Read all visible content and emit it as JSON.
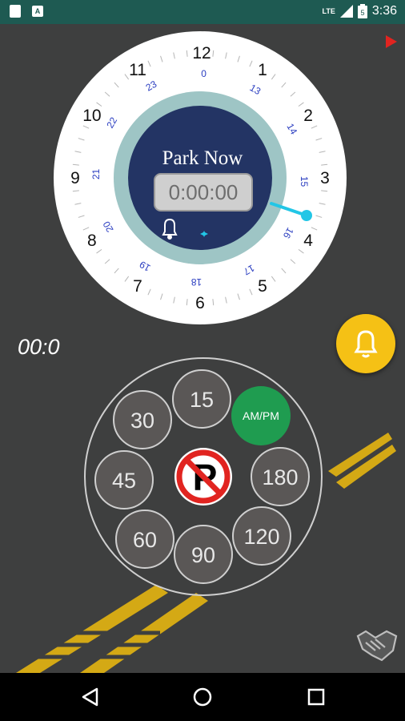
{
  "status_bar": {
    "time": "3:36",
    "network": "LTE",
    "battery_level": "5"
  },
  "dial": {
    "title": "Park Now",
    "timer": "0:00:00",
    "outer_numbers": [
      "12",
      "1",
      "2",
      "3",
      "4",
      "5",
      "6",
      "7",
      "8",
      "9",
      "10",
      "11"
    ],
    "inner_numbers": [
      "0",
      "13",
      "14",
      "15",
      "16",
      "17",
      "18",
      "19",
      "20",
      "21",
      "22",
      "23"
    ]
  },
  "digital_clock": "00:0",
  "quick_durations": {
    "buttons": [
      "15",
      "180",
      "120",
      "90",
      "60",
      "45",
      "30"
    ],
    "ampm_label": "AM/PM"
  },
  "colors": {
    "status_bar": "#1e5a52",
    "background": "#3e3f3f",
    "dial_navy": "#233464",
    "dial_ring": "#9ec5c5",
    "hand": "#22c6e6",
    "alarm": "#f5c115",
    "ampm": "#1f9c50",
    "road_line": "#d4a915",
    "inner_numbers": "#2a3dc0"
  },
  "icons": {
    "play": "play-icon",
    "bell": "bell-icon",
    "move": "move-icon",
    "no_parking": "no-parking-icon",
    "handshake": "handshake-icon",
    "back": "back-icon",
    "home": "home-icon",
    "recents": "recents-icon"
  }
}
